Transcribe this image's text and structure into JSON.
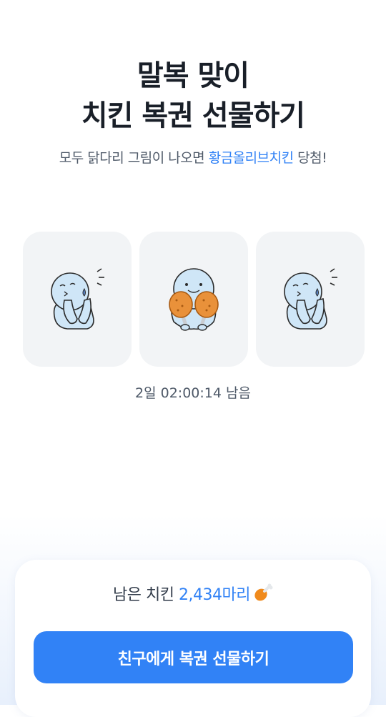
{
  "title": {
    "line1": "말복 맞이",
    "line2": "치킨 복권 선물하기"
  },
  "subtitle": {
    "prefix": "모두 닭다리 그림이 나오면 ",
    "highlight": "황금올리브치킨",
    "suffix": " 당첨!"
  },
  "cards": [
    {
      "character": "worried-character",
      "state": "miss"
    },
    {
      "character": "character-holding-drumsticks",
      "state": "hit"
    },
    {
      "character": "worried-character",
      "state": "miss"
    }
  ],
  "timer": "2일 02:00:14 남음",
  "remaining": {
    "label": "남은 치킨",
    "count": "2,434마리",
    "icon": "drumstick-icon"
  },
  "cta": {
    "label": "친구에게 복권 선물하기"
  },
  "colors": {
    "accent": "#3182f6",
    "card_bg": "#f2f4f6",
    "text_primary": "#191f28",
    "text_secondary": "#4e5968",
    "drumstick": "#f08a1c"
  }
}
